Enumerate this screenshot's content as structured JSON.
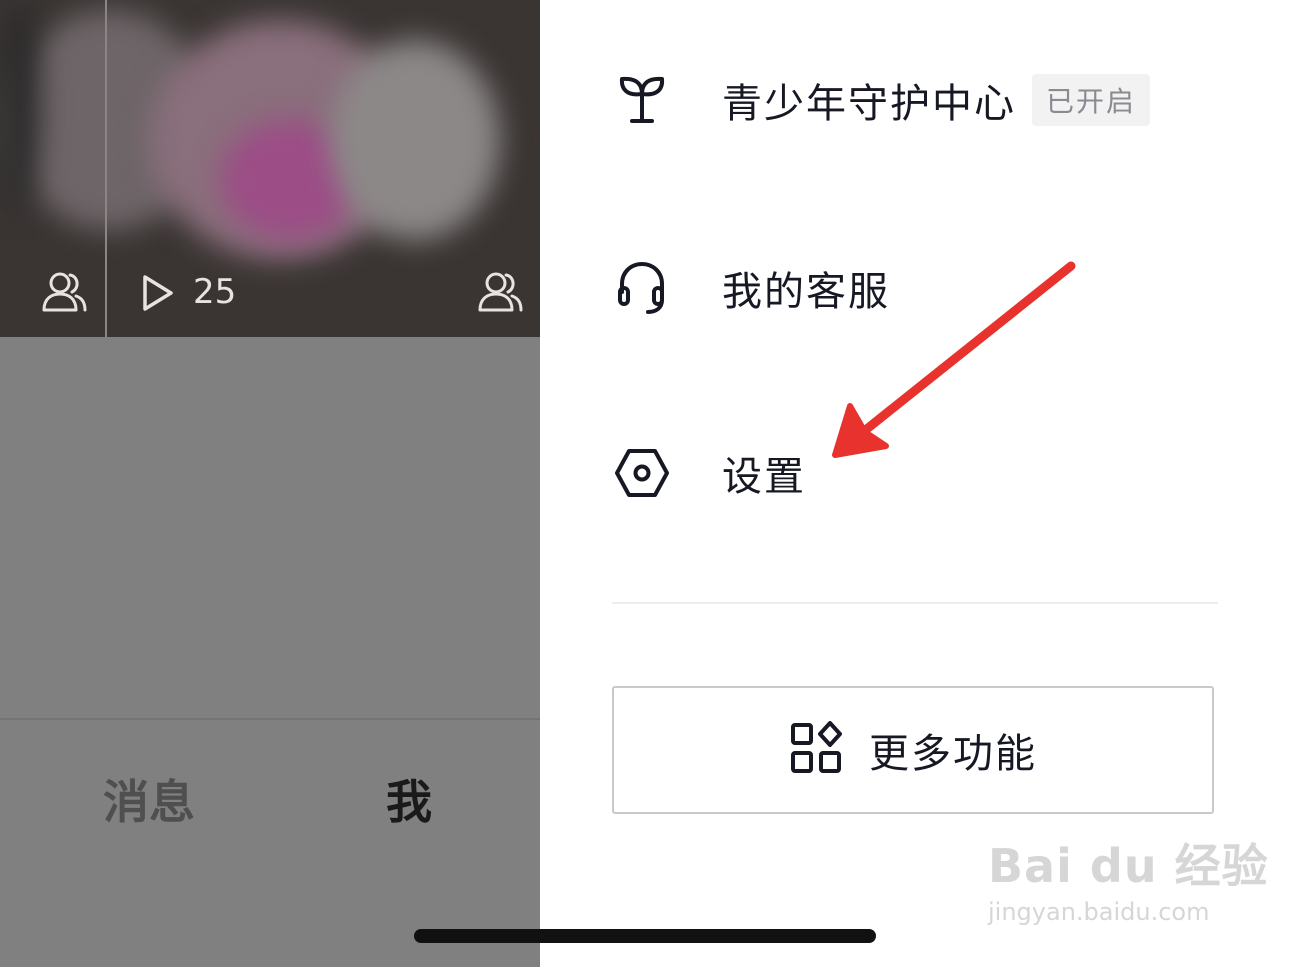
{
  "video_grid": {
    "play_count": "25"
  },
  "bottom_tabs": {
    "messages_label": "消息",
    "me_label": "我"
  },
  "drawer": {
    "items": [
      {
        "label": "青少年守护中心",
        "badge": "已开启",
        "icon": "sprout-icon"
      },
      {
        "label": "我的客服",
        "icon": "headset-icon"
      },
      {
        "label": "设置",
        "icon": "settings-hexagon-icon"
      }
    ],
    "more_button": {
      "label": "更多功能",
      "icon": "apps-grid-icon"
    }
  },
  "watermark": {
    "logo_text": "Bai du 经验",
    "url": "jingyan.baidu.com"
  },
  "colors": {
    "annotation_arrow": "#e8322e",
    "dim_overlay": "#808080",
    "drawer_bg": "#ffffff"
  }
}
